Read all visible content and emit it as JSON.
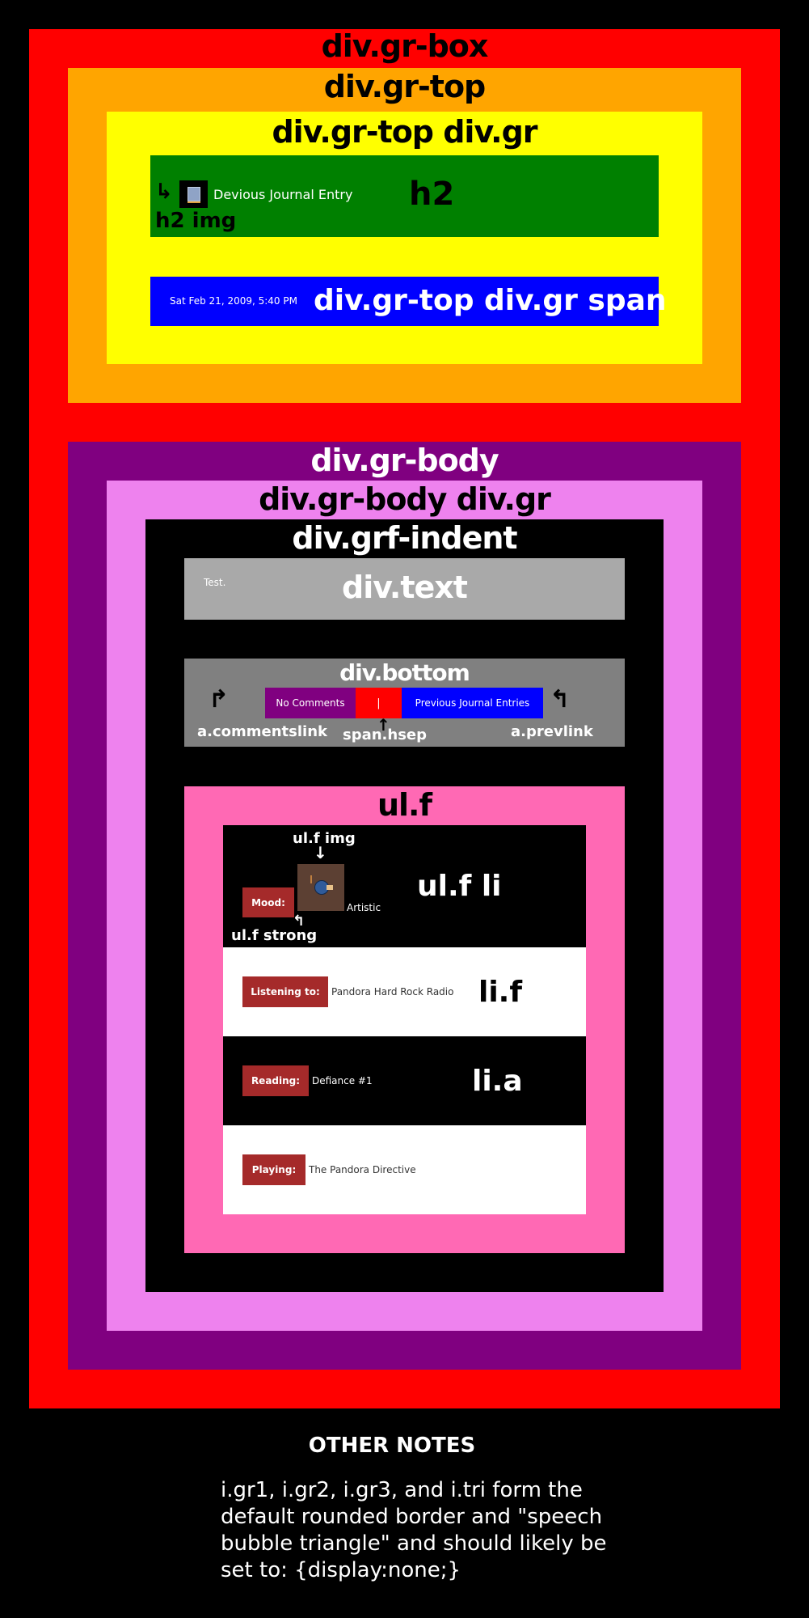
{
  "labels": {
    "gr_box": "div.gr-box",
    "gr_top": "div.gr-top",
    "gr_top_gr": "div.gr-top div.gr",
    "h2": "h2",
    "h2_img": "h2 img",
    "gr_top_span": "div.gr-top div.gr span",
    "gr_body": "div.gr-body",
    "gr_body_gr": "div.gr-body div.gr",
    "grf_indent": "div.grf-indent",
    "div_text": "div.text",
    "div_bottom": "div.bottom",
    "commentslink": "a.commentslink",
    "hsep": "span.hsep",
    "prevlink": "a.prevlink",
    "ul_f": "ul.f",
    "ul_f_img": "ul.f img",
    "ul_f_li": "ul.f li",
    "ul_f_strong": "ul.f strong",
    "li_f": "li.f",
    "li_a": "li.a"
  },
  "entry": {
    "title": "Devious Journal Entry",
    "icon": "journal-icon",
    "timestamp": "Sat Feb 21, 2009, 5:40 PM",
    "text": "Test."
  },
  "bottom": {
    "comments_link": "No Comments",
    "separator": "|",
    "prev_link": "Previous Journal Entries"
  },
  "fields": [
    {
      "label": "Mood:",
      "value": "Artistic",
      "icon": "artistic-mood-icon"
    },
    {
      "label": "Listening to:",
      "value": "Pandora Hard Rock Radio"
    },
    {
      "label": "Reading:",
      "value": "Defiance #1"
    },
    {
      "label": "Playing:",
      "value": "The Pandora Directive"
    }
  ],
  "notes": {
    "heading": "OTHER NOTES",
    "line1": "i.gr1, i.gr2, i.gr3, and i.tri form the",
    "line2": "default rounded border and \"speech",
    "line3": "bubble triangle\" and should likely be",
    "line4": "set to: {display:none;}"
  },
  "colors": {
    "gr_box": "#ff0000",
    "gr_top": "#ffa500",
    "gr_top_gr": "#ffff00",
    "h2": "#008000",
    "span": "#0000ff",
    "gr_body": "#800080",
    "gr_body_gr": "#ee82ee",
    "grf_indent": "#000000",
    "text": "#a9a9a9",
    "bottom": "#808080",
    "ul_f": "#ff69b4",
    "strong": "#a52a2a"
  }
}
